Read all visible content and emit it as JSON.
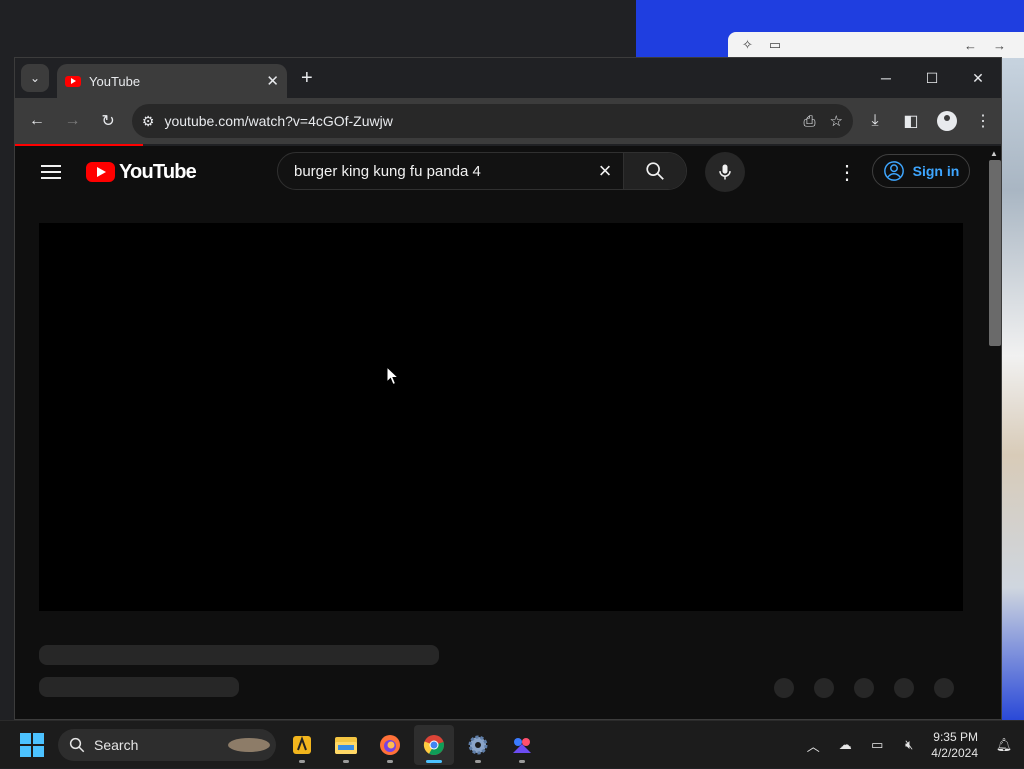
{
  "background_window": {
    "icons": [
      "rocket-icon",
      "sidebar-icon",
      "back-arrow-icon",
      "forward-arrow-icon"
    ]
  },
  "browser": {
    "tab": {
      "title": "YouTube"
    },
    "address": {
      "url": "youtube.com/watch?v=4cGOf-Zuwjw"
    },
    "page_load_progress": 0.13
  },
  "youtube": {
    "logo_text": "YouTube",
    "search": {
      "query": "burger king kung fu panda 4"
    },
    "sign_in_label": "Sign in",
    "colors": {
      "brand": "#ff0000",
      "link": "#3ea6ff",
      "background": "#0f0f0f"
    }
  },
  "taskbar": {
    "search_label": "Search",
    "apps": [
      "pre-app-icon",
      "file-explorer-icon",
      "firefox-icon",
      "chrome-icon",
      "settings-icon",
      "feedback-app-icon"
    ],
    "active_app": "chrome-icon",
    "clock": {
      "time": "9:35 PM",
      "date": "4/2/2024"
    }
  }
}
